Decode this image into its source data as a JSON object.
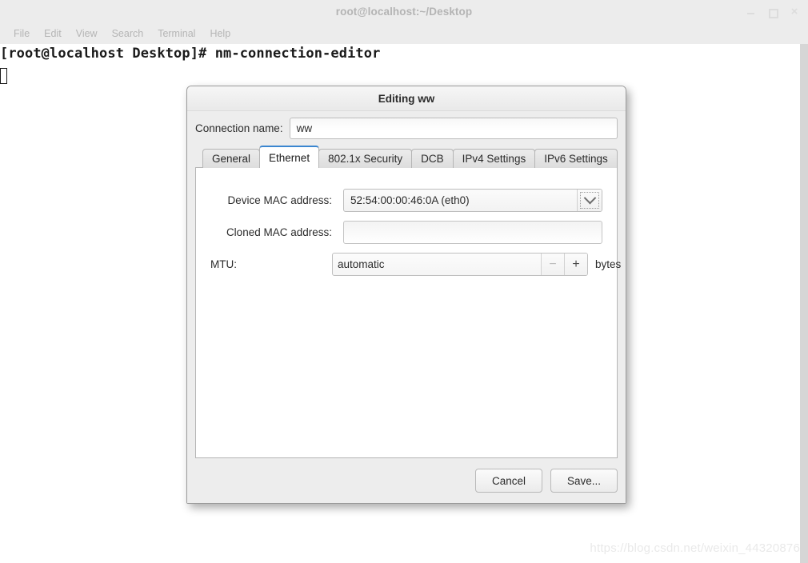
{
  "terminal": {
    "title": "root@localhost:~/Desktop",
    "menus": [
      "File",
      "Edit",
      "View",
      "Search",
      "Terminal",
      "Help"
    ],
    "prompt_line": "[root@localhost Desktop]# nm-connection-editor",
    "window_controls": {
      "minimize": "minimize-icon",
      "maximize": "maximize-icon",
      "close": "×"
    }
  },
  "watermark": "https://blog.csdn.net/weixin_44320876",
  "dialog": {
    "title": "Editing ww",
    "connection_name_label": "Connection name:",
    "connection_name_value": "ww",
    "tabs": [
      {
        "label": "General",
        "active": false
      },
      {
        "label": "Ethernet",
        "active": true
      },
      {
        "label": "802.1x Security",
        "active": false
      },
      {
        "label": "DCB",
        "active": false
      },
      {
        "label": "IPv4 Settings",
        "active": false
      },
      {
        "label": "IPv6 Settings",
        "active": false
      }
    ],
    "ethernet": {
      "device_mac_label": "Device MAC address:",
      "device_mac_value": "52:54:00:00:46:0A (eth0)",
      "cloned_mac_label": "Cloned MAC address:",
      "cloned_mac_value": "",
      "mtu_label": "MTU:",
      "mtu_value": "automatic",
      "mtu_units": "bytes",
      "spin_minus": "−",
      "spin_plus": "+"
    },
    "buttons": {
      "cancel": "Cancel",
      "save": "Save..."
    },
    "accent_color": "#3b86d0"
  }
}
